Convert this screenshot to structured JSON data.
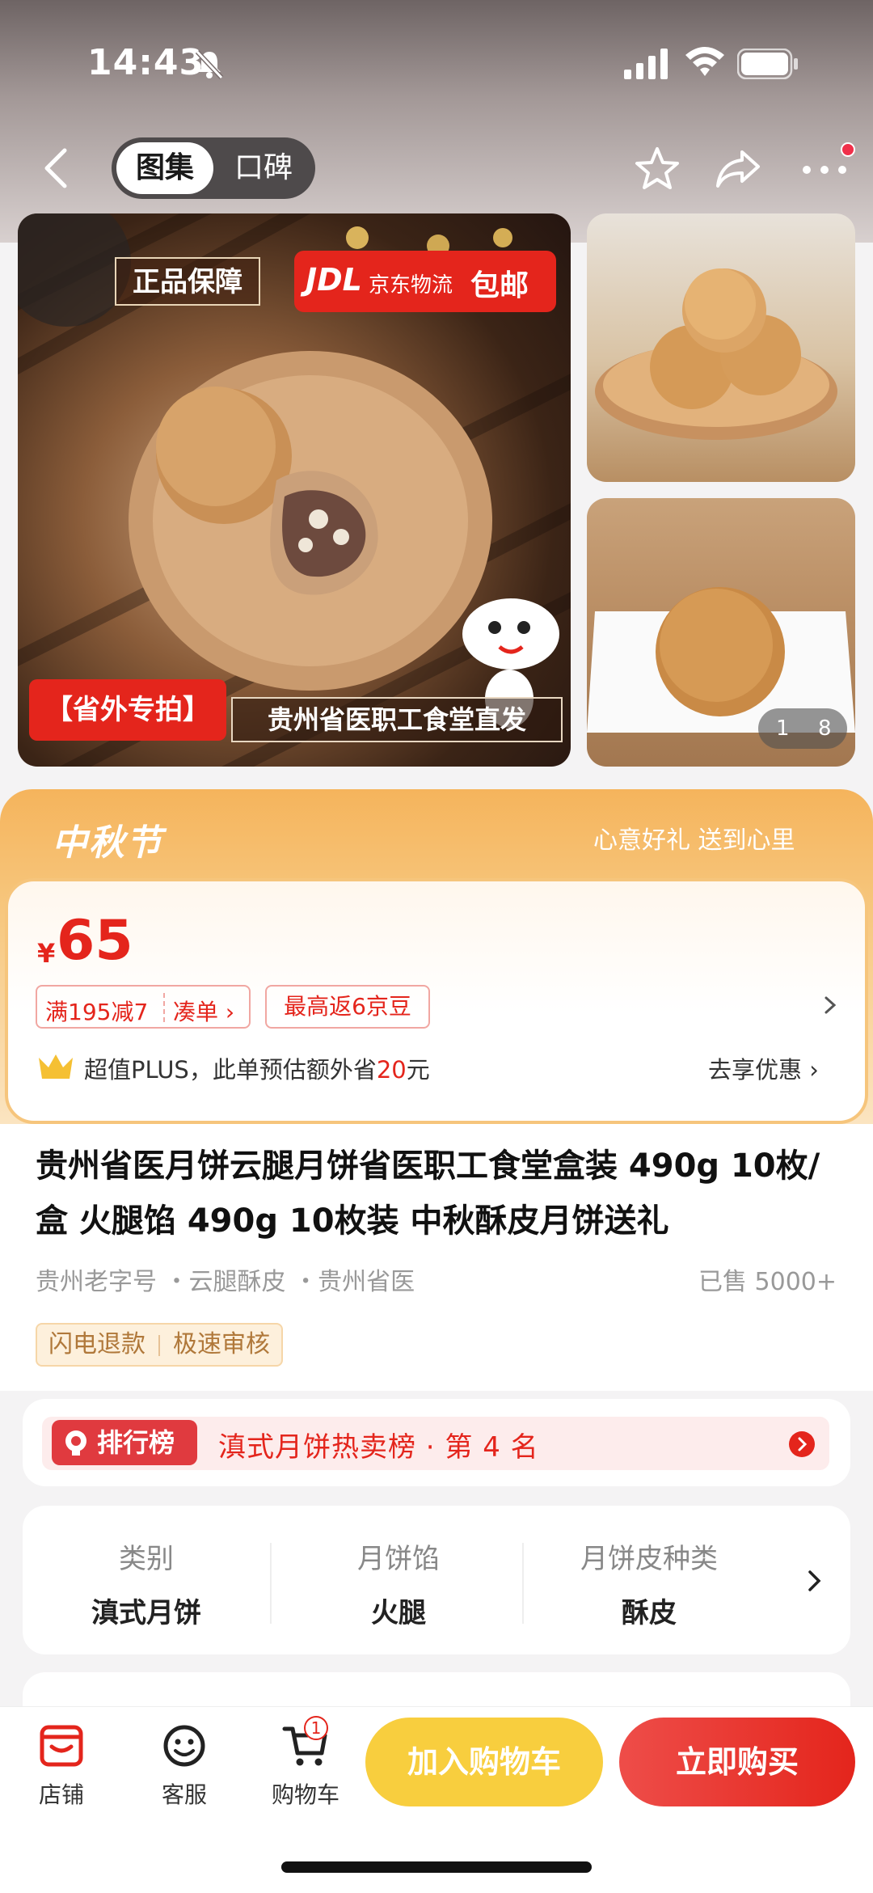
{
  "status": {
    "time": "14:43"
  },
  "header": {
    "tabs": [
      {
        "label": "图集"
      },
      {
        "label": "口碑"
      }
    ]
  },
  "gallery": {
    "badge_genuine": "正品保障",
    "badge_jdl_logo": "JDL",
    "badge_jdl_text": "京东物流",
    "badge_free_shipping": "包邮",
    "badge_out_province": "【省外专拍】",
    "badge_direct": "贵州省医职工食堂直发",
    "page_current": "1",
    "page_total": "8"
  },
  "festival": {
    "title": "中秋节",
    "slogan": "心意好礼 送到心里"
  },
  "price": {
    "symbol": "¥",
    "value": "65",
    "promo_discount": "满195减7",
    "promo_combine": "凑单 ›",
    "promo_beans": "最高返6京豆",
    "plus_prefix": "超值PLUS，此单预估额外省",
    "plus_amount": "20",
    "plus_suffix": "元",
    "go_discount": "去享优惠 ›"
  },
  "product": {
    "title": "贵州省医月饼云腿月饼省医职工食堂盒装 490g 10枚/盒 火腿馅 490g 10枚装 中秋酥皮月饼送礼",
    "tags": "贵州老字号 ・云腿酥皮 ・贵州省医",
    "sold": "已售 5000+",
    "refund": "闪电退款",
    "review": "极速审核"
  },
  "rank": {
    "badge": "排行榜",
    "text": "滇式月饼热卖榜 · 第 4 名"
  },
  "attributes": [
    {
      "label": "类别",
      "value": "滇式月饼"
    },
    {
      "label": "月饼馅",
      "value": "火腿"
    },
    {
      "label": "月饼皮种类",
      "value": "酥皮"
    }
  ],
  "bottom_nav": {
    "store": "店铺",
    "service": "客服",
    "cart": "购物车",
    "cart_count": "1",
    "add_to_cart": "加入购物车",
    "buy_now": "立即购买"
  },
  "colors": {
    "brand_red": "#e4251c",
    "cart_yellow": "#f8ce3e",
    "festival_orange": "#f5b45c"
  }
}
